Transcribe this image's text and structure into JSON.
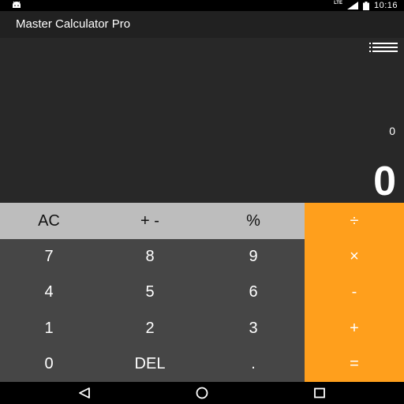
{
  "status_bar": {
    "network": "LTE",
    "time": "10:16",
    "icons": [
      "android-icon",
      "signal-icon",
      "battery-icon"
    ]
  },
  "app": {
    "title": "Master Calculator Pro"
  },
  "display": {
    "expression": "0",
    "result": "0",
    "history_icon": "history-list-icon"
  },
  "keypad": {
    "rows": [
      [
        "AC",
        "+ -",
        "%",
        "÷"
      ],
      [
        "7",
        "8",
        "9",
        "×"
      ],
      [
        "4",
        "5",
        "6",
        "-"
      ],
      [
        "1",
        "2",
        "3",
        "+"
      ],
      [
        "0",
        "DEL",
        ".",
        "="
      ]
    ]
  },
  "colors": {
    "operator": "#ff9f1c",
    "function_row": "#bdbdbd",
    "number_pad": "#464646",
    "display_bg": "#282828",
    "app_bar": "#212121"
  },
  "nav_bar": {
    "icons": [
      "back-icon",
      "home-icon",
      "recents-icon"
    ]
  }
}
